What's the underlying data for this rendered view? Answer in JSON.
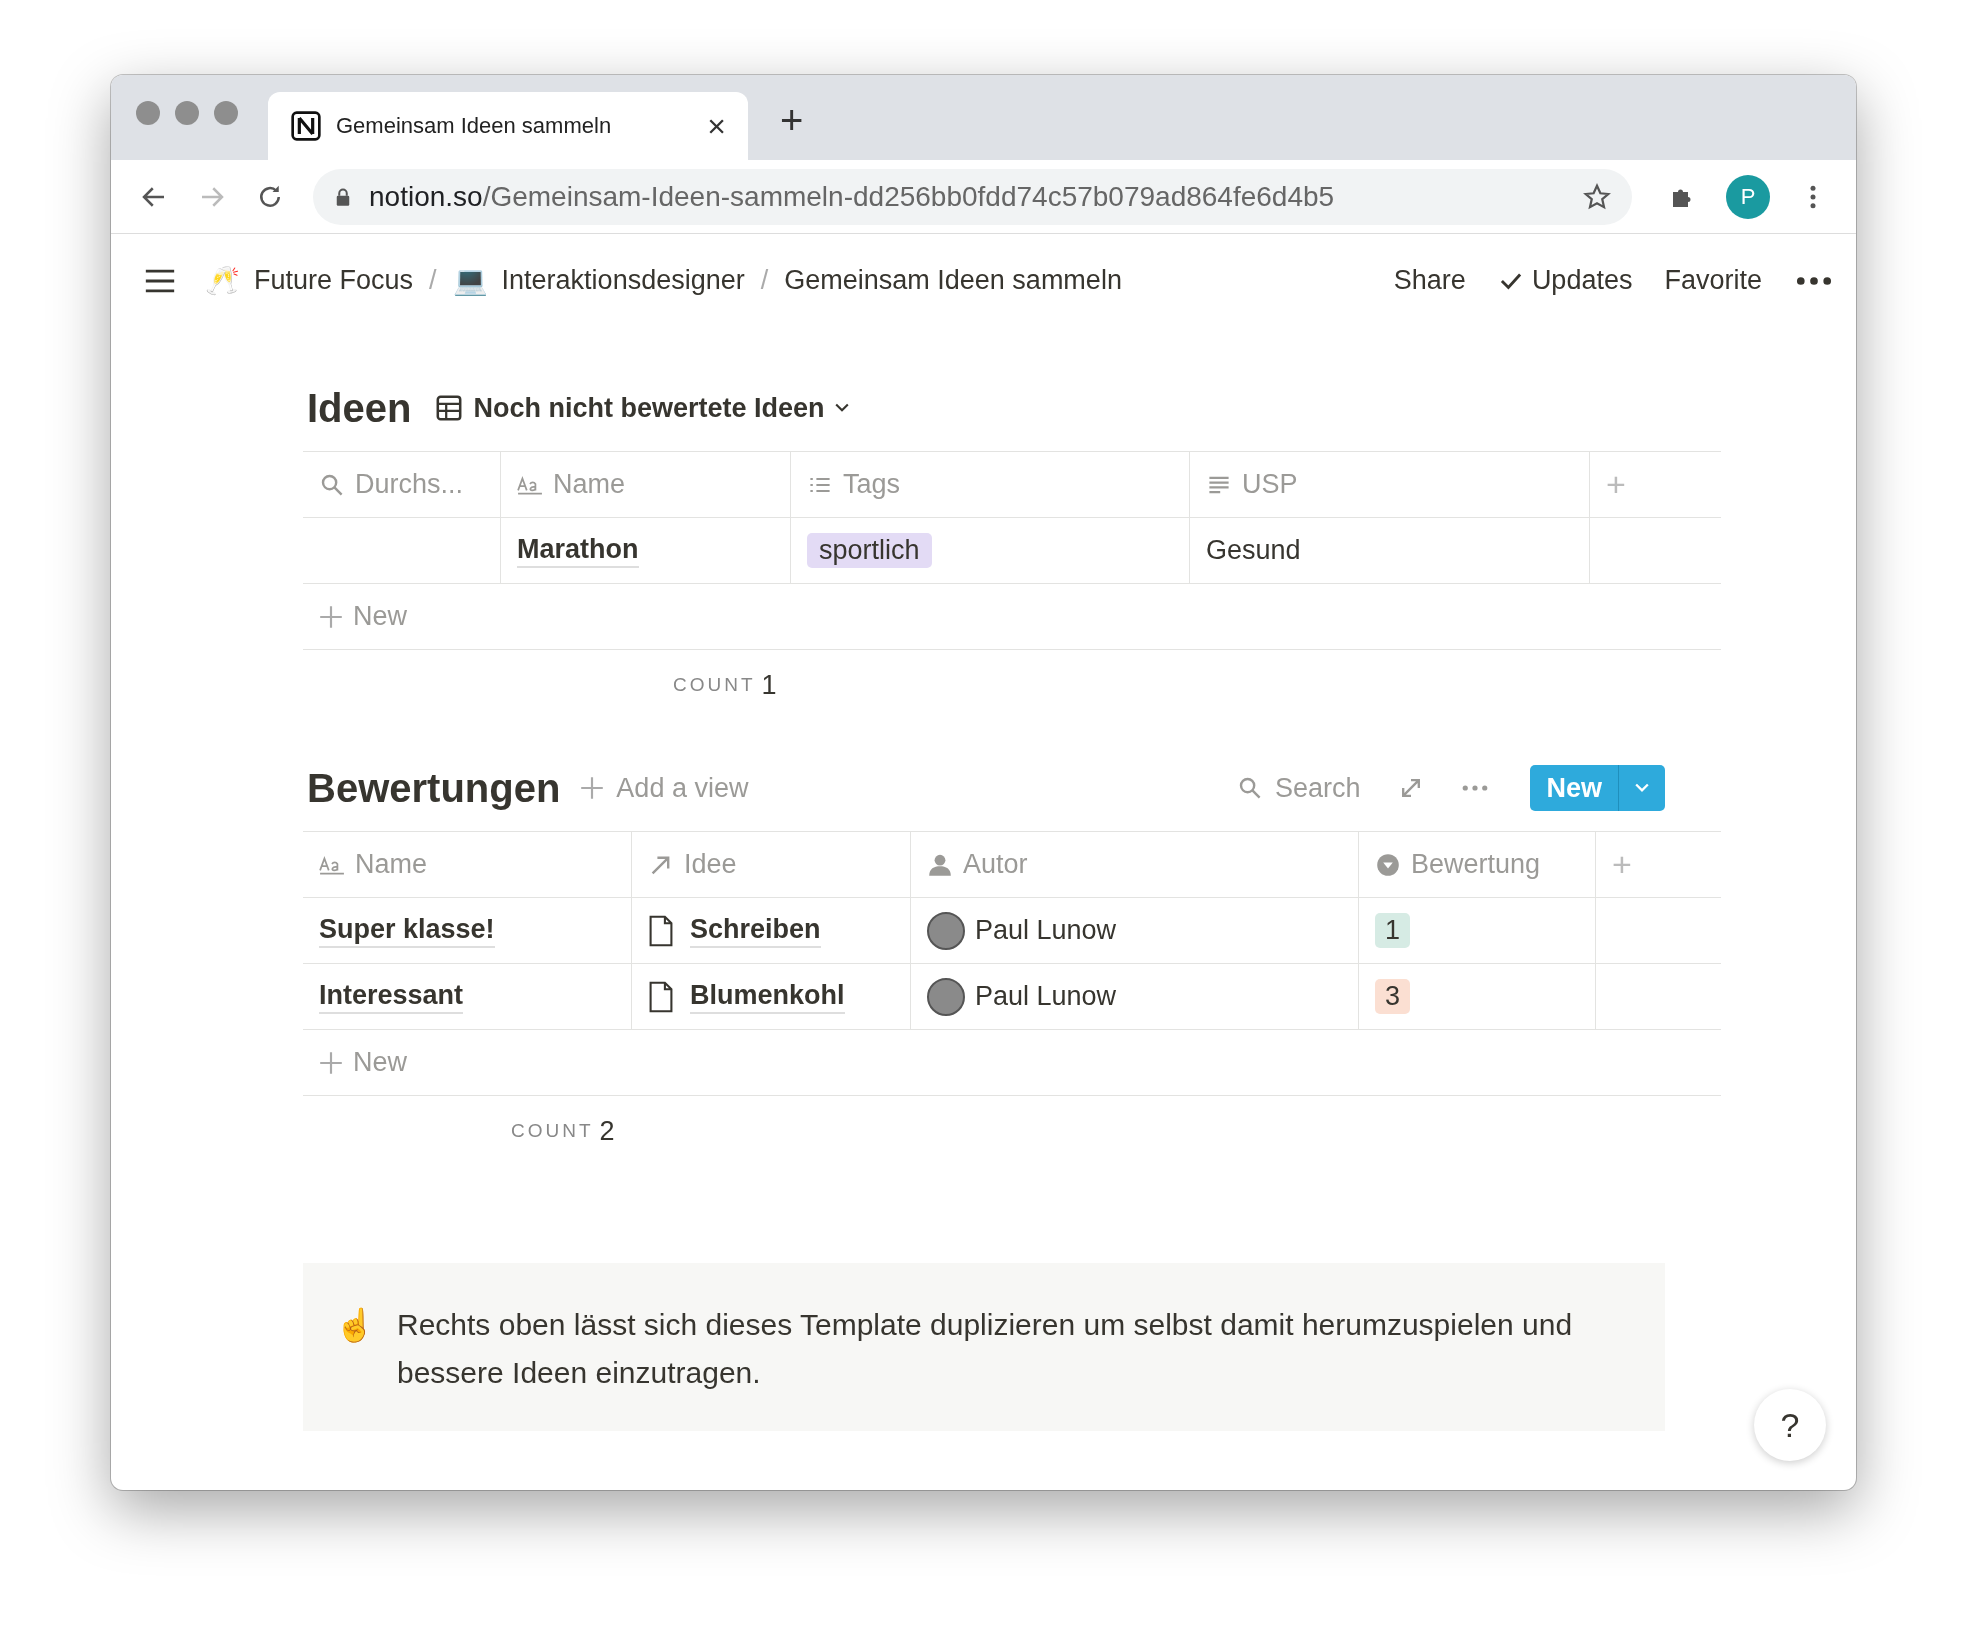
{
  "browser": {
    "tab_title": "Gemeinsam Ideen sammeln",
    "tab_close": "×",
    "new_tab": "+",
    "url_host": "notion.so",
    "url_path": "/Gemeinsam-Ideen-sammeln-dd256bb0fdd74c57b079ad864fe6d4b5",
    "profile_initial": "P"
  },
  "topbar": {
    "breadcrumbs": [
      {
        "emoji": "🥂",
        "label": "Future Focus"
      },
      {
        "emoji": "💻",
        "label": "Interaktionsdesigner"
      },
      {
        "label": "Gemeinsam Ideen sammeln"
      }
    ],
    "separator": "/",
    "actions": [
      "Share",
      "Updates",
      "Favorite"
    ]
  },
  "ideen": {
    "title": "Ideen",
    "view": "Noch nicht bewertete Ideen",
    "columns": [
      {
        "kind": "search",
        "label": "Durchs..."
      },
      {
        "kind": "title",
        "label": "Name"
      },
      {
        "kind": "list",
        "label": "Tags"
      },
      {
        "kind": "text",
        "label": "USP"
      }
    ],
    "add_column": "+",
    "rows": [
      {
        "name": "Marathon",
        "tags": [
          {
            "label": "sportlich",
            "color": "#e3dbf5"
          }
        ],
        "usp": "Gesund"
      }
    ],
    "new_row": "New",
    "count_label": "COUNT",
    "count": "1"
  },
  "bewertungen": {
    "title": "Bewertungen",
    "add_view": "Add a view",
    "search": "Search",
    "new_button": "New",
    "columns": [
      {
        "kind": "title",
        "label": "Name"
      },
      {
        "kind": "relation",
        "label": "Idee"
      },
      {
        "kind": "person",
        "label": "Autor"
      },
      {
        "kind": "select",
        "label": "Bewertung"
      }
    ],
    "add_column": "+",
    "rows": [
      {
        "name": "Super klasse!",
        "idee": "Schreiben",
        "autor": "Paul Lunow",
        "rating": {
          "label": "1",
          "color": "#d6ebe4"
        }
      },
      {
        "name": "Interessant",
        "idee": "Blumenkohl",
        "autor": "Paul Lunow",
        "rating": {
          "label": "3",
          "color": "#fbdfd2"
        }
      }
    ],
    "new_row": "New",
    "count_label": "COUNT",
    "count": "2"
  },
  "callout": {
    "emoji": "☝️",
    "text": "Rechts oben lässt sich dieses Template duplizieren um selbst damit herumzuspielen und bessere Ideen einzutragen."
  },
  "help_button": "?"
}
